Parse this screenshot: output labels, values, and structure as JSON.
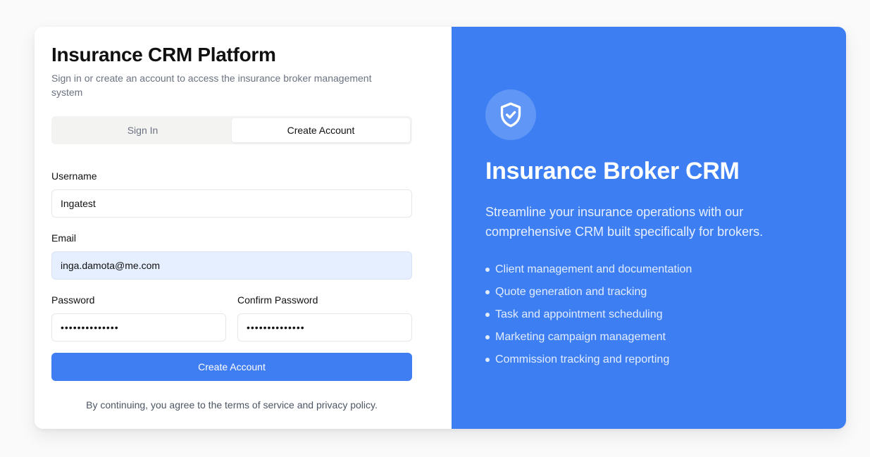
{
  "brand": {
    "title": "Insurance CRM Platform",
    "subtitle": "Sign in or create an account to access the insurance broker management system"
  },
  "tabs": [
    {
      "label": "Sign In",
      "active": false
    },
    {
      "label": "Create Account",
      "active": true
    }
  ],
  "form": {
    "username": {
      "label": "Username",
      "value": "Ingatest"
    },
    "email": {
      "label": "Email",
      "value": "inga.damota@me.com"
    },
    "password": {
      "label": "Password",
      "value": "••••••••••••••"
    },
    "confirm_password": {
      "label": "Confirm Password",
      "value": "••••••••••••••"
    },
    "submit_label": "Create Account",
    "terms": "By continuing, you agree to the terms of service and privacy policy."
  },
  "hero": {
    "icon": "shield-check-icon",
    "title": "Insurance Broker CRM",
    "description": "Streamline your insurance operations with our comprehensive CRM built specifically for brokers.",
    "features": [
      "Client management and documentation",
      "Quote generation and tracking",
      "Task and appointment scheduling",
      "Marketing campaign management",
      "Commission tracking and reporting"
    ]
  },
  "colors": {
    "accent": "#3d7ff3",
    "autofill_bg": "#e6efff",
    "tab_bg": "#f3f3f2"
  }
}
